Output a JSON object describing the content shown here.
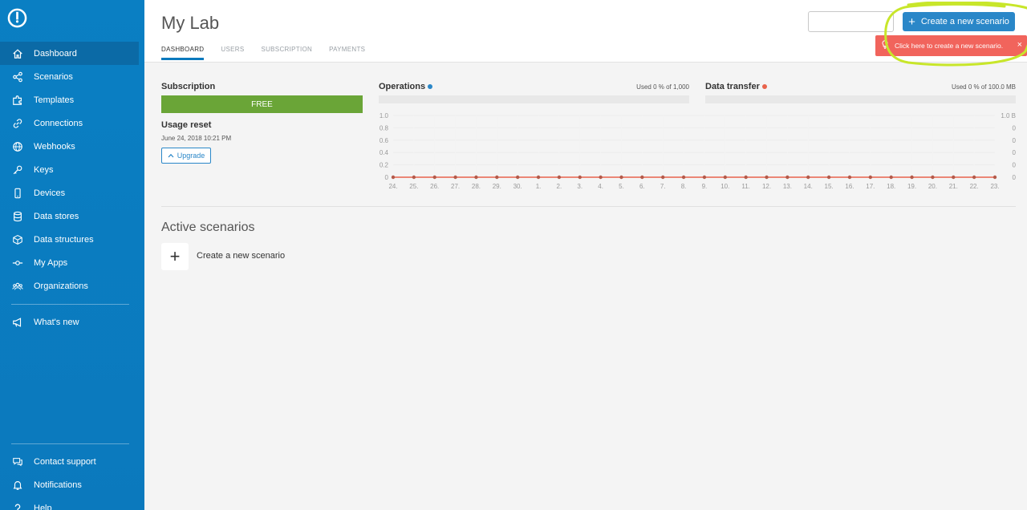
{
  "app": {
    "brand_color": "#0b79bd",
    "accent": "#2a87c8"
  },
  "sidebar": {
    "items": [
      {
        "label": "Dashboard",
        "icon": "home-icon"
      },
      {
        "label": "Scenarios",
        "icon": "share-nodes-icon"
      },
      {
        "label": "Templates",
        "icon": "puzzle-icon"
      },
      {
        "label": "Connections",
        "icon": "link-icon"
      },
      {
        "label": "Webhooks",
        "icon": "globe-icon"
      },
      {
        "label": "Keys",
        "icon": "key-icon"
      },
      {
        "label": "Devices",
        "icon": "phone-icon"
      },
      {
        "label": "Data stores",
        "icon": "database-icon"
      },
      {
        "label": "Data structures",
        "icon": "cube-icon"
      },
      {
        "label": "My Apps",
        "icon": "node-icon"
      },
      {
        "label": "Organizations",
        "icon": "people-icon"
      }
    ],
    "whats_new": "What's new",
    "bottom": [
      {
        "label": "Contact support",
        "icon": "chat-icon"
      },
      {
        "label": "Notifications",
        "icon": "bell-icon"
      },
      {
        "label": "Help",
        "icon": "question-icon"
      }
    ]
  },
  "header": {
    "title": "My Lab",
    "tabs": [
      "DASHBOARD",
      "USERS",
      "SUBSCRIPTION",
      "PAYMENTS"
    ],
    "create_button": "Create a new scenario",
    "tooltip": "Click here to create a new scenario.",
    "tooltip_close": "×"
  },
  "subscription": {
    "title": "Subscription",
    "plan": "FREE",
    "usage_reset_title": "Usage reset",
    "usage_reset_date": "June 24, 2018 10:21 PM",
    "upgrade_label": "Upgrade"
  },
  "operations": {
    "title": "Operations",
    "used": "Used 0 % of 1,000",
    "dot_color": "#2a87c8"
  },
  "data_transfer": {
    "title": "Data transfer",
    "used": "Used 0 % of 100.0 MB",
    "dot_color": "#e8634c"
  },
  "chart_data": {
    "type": "line",
    "categories": [
      "24.",
      "25.",
      "26.",
      "27.",
      "28.",
      "29.",
      "30.",
      "1.",
      "2.",
      "3.",
      "4.",
      "5.",
      "6.",
      "7.",
      "8.",
      "9.",
      "10.",
      "11.",
      "12.",
      "13.",
      "14.",
      "15.",
      "16.",
      "17.",
      "18.",
      "19.",
      "20.",
      "21.",
      "22.",
      "23."
    ],
    "series": [
      {
        "values": [
          0,
          0,
          0,
          0,
          0,
          0,
          0,
          0,
          0,
          0,
          0,
          0,
          0,
          0,
          0,
          0,
          0,
          0,
          0,
          0,
          0,
          0,
          0,
          0,
          0,
          0,
          0,
          0,
          0,
          0
        ],
        "color": "#e8634c"
      }
    ],
    "y_left_ticks": [
      "1.0",
      "0.8",
      "0.6",
      "0.4",
      "0.2",
      "0"
    ],
    "y_right_ticks": [
      "1.0 B",
      "0",
      "0",
      "0",
      "0",
      "0"
    ],
    "ylim": [
      0,
      1
    ]
  },
  "active": {
    "title": "Active scenarios",
    "new_label": "Create a new scenario",
    "new_plus": "+"
  }
}
